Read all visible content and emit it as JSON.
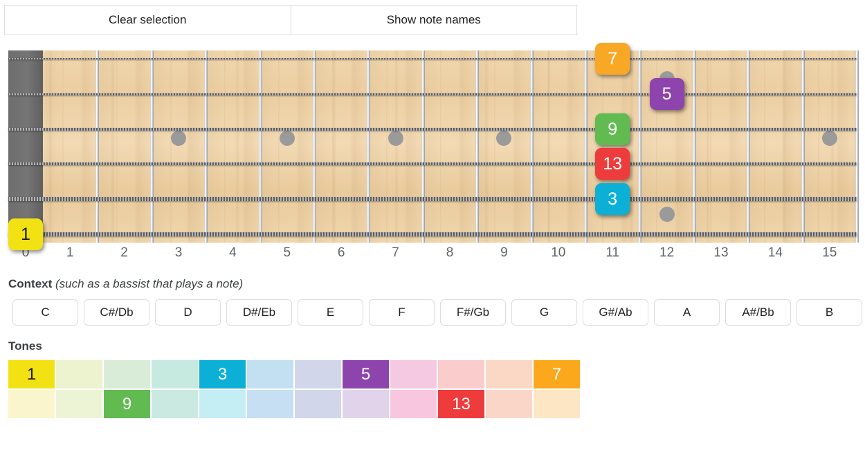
{
  "toolbar": {
    "clear_label": "Clear selection",
    "show_notes_label": "Show note names"
  },
  "fretboard": {
    "fret_numbers": [
      "0",
      "1",
      "2",
      "3",
      "4",
      "5",
      "6",
      "7",
      "8",
      "9",
      "10",
      "11",
      "12",
      "13",
      "14",
      "15"
    ],
    "string_count": 6,
    "inlay_frets": [
      3,
      5,
      7,
      9,
      12,
      15
    ],
    "markers": [
      {
        "label": "7",
        "color": "#F9A826",
        "text_color": "#ffffff",
        "fret": 11,
        "string": 1
      },
      {
        "label": "5",
        "color": "#8E44AD",
        "text_color": "#ffffff",
        "fret": 12,
        "string": 2
      },
      {
        "label": "9",
        "color": "#62BB51",
        "text_color": "#ffffff",
        "fret": 11,
        "string": 3
      },
      {
        "label": "13",
        "color": "#EE3B3B",
        "text_color": "#ffffff",
        "fret": 11,
        "string": 4
      },
      {
        "label": "3",
        "color": "#0CB0D6",
        "text_color": "#ffffff",
        "fret": 11,
        "string": 5
      },
      {
        "label": "1",
        "color": "#F2E213",
        "text_color": "#1a1a1a",
        "fret": 0,
        "string": 6
      }
    ]
  },
  "context": {
    "title": "Context",
    "subtitle": "(such as a bassist that plays a note)",
    "notes": [
      "C",
      "C#/Db",
      "D",
      "D#/Eb",
      "E",
      "F",
      "F#/Gb",
      "G",
      "G#/Ab",
      "A",
      "A#/Bb",
      "B"
    ]
  },
  "tones": {
    "title": "Tones",
    "row1": [
      {
        "label": "1",
        "color": "#F2E213",
        "text_color": "#1a1a1a",
        "active": true
      },
      {
        "label": "",
        "color": "#EDF3CE",
        "text_color": "#ffffff",
        "active": false
      },
      {
        "label": "",
        "color": "#D9ECD7",
        "text_color": "#ffffff",
        "active": false
      },
      {
        "label": "",
        "color": "#C6E9E0",
        "text_color": "#ffffff",
        "active": false
      },
      {
        "label": "3",
        "color": "#0CB0D6",
        "text_color": "#ffffff",
        "active": true
      },
      {
        "label": "",
        "color": "#C3DFF2",
        "text_color": "#ffffff",
        "active": false
      },
      {
        "label": "",
        "color": "#D2D6EA",
        "text_color": "#ffffff",
        "active": false
      },
      {
        "label": "5",
        "color": "#8E44AD",
        "text_color": "#ffffff",
        "active": true
      },
      {
        "label": "",
        "color": "#F6C9E2",
        "text_color": "#ffffff",
        "active": false
      },
      {
        "label": "",
        "color": "#FACDCC",
        "text_color": "#ffffff",
        "active": false
      },
      {
        "label": "",
        "color": "#FBD8C6",
        "text_color": "#ffffff",
        "active": false
      },
      {
        "label": "7",
        "color": "#FBA81C",
        "text_color": "#ffffff",
        "active": true
      }
    ],
    "row2": [
      {
        "label": "",
        "color": "#FAF5CC",
        "text_color": "#ffffff",
        "active": false
      },
      {
        "label": "",
        "color": "#EDF3D5",
        "text_color": "#ffffff",
        "active": false
      },
      {
        "label": "9",
        "color": "#62BB51",
        "text_color": "#ffffff",
        "active": true
      },
      {
        "label": "",
        "color": "#C9E9E1",
        "text_color": "#ffffff",
        "active": false
      },
      {
        "label": "",
        "color": "#C5EDF4",
        "text_color": "#ffffff",
        "active": false
      },
      {
        "label": "",
        "color": "#C6DFF3",
        "text_color": "#ffffff",
        "active": false
      },
      {
        "label": "",
        "color": "#D2D6EA",
        "text_color": "#ffffff",
        "active": false
      },
      {
        "label": "",
        "color": "#E1D4EA",
        "text_color": "#ffffff",
        "active": false
      },
      {
        "label": "",
        "color": "#F9C6E0",
        "text_color": "#ffffff",
        "active": false
      },
      {
        "label": "13",
        "color": "#EE3B3B",
        "text_color": "#ffffff",
        "active": true
      },
      {
        "label": "",
        "color": "#FAD6C9",
        "text_color": "#ffffff",
        "active": false
      },
      {
        "label": "",
        "color": "#FCE6C3",
        "text_color": "#ffffff",
        "active": false
      }
    ]
  }
}
